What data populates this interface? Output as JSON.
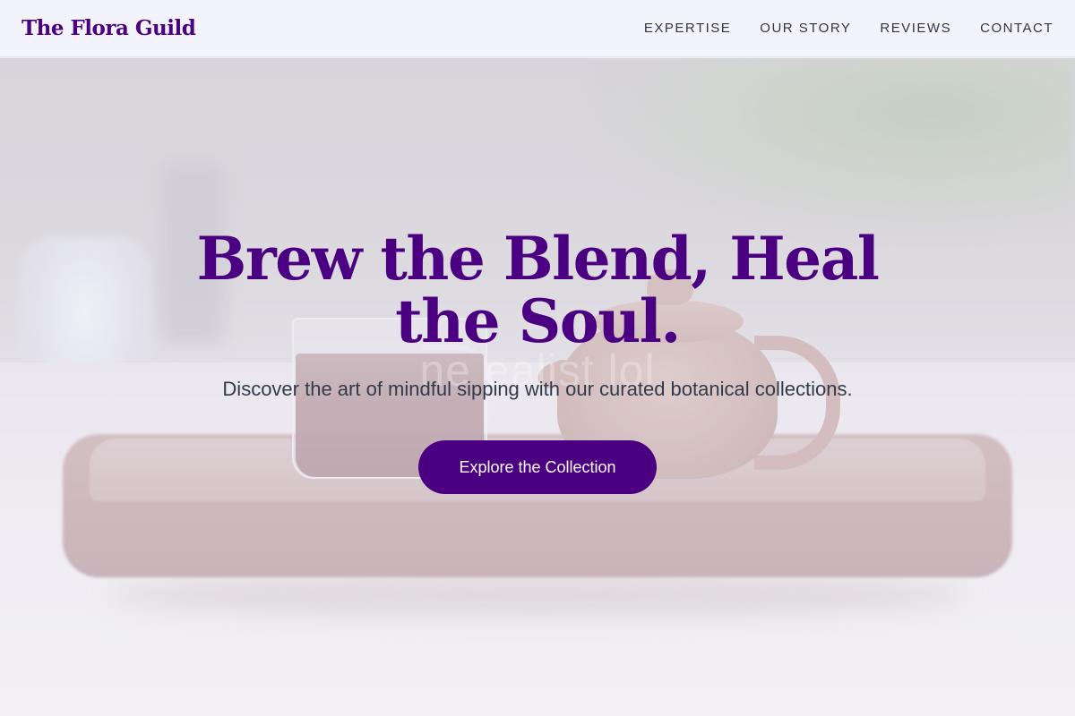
{
  "header": {
    "brand": "The Flora Guild",
    "nav": [
      {
        "label": "EXPERTISE"
      },
      {
        "label": "OUR STORY"
      },
      {
        "label": "REVIEWS"
      },
      {
        "label": "CONTACT"
      }
    ]
  },
  "hero": {
    "headline": "Brew the Blend, Heal the Soul.",
    "subheadline": "Discover the art of mindful sipping with our curated botanical collections.",
    "cta_label": "Explore the Collection",
    "watermark": "ne ealist lol"
  },
  "colors": {
    "brand": "#4b0082",
    "header_bg": "#f3f3fb",
    "cta_text": "#ffffff"
  }
}
